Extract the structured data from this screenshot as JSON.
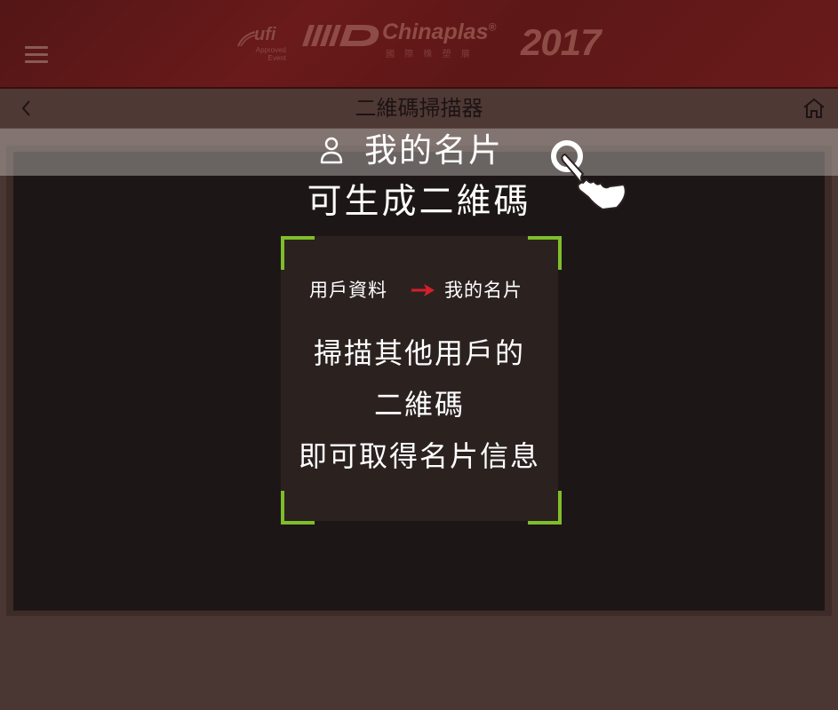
{
  "header": {
    "menu_icon": "hamburger-menu-icon",
    "ufi_logo": {
      "mark": "ufi",
      "lines": [
        "Approved",
        "Event"
      ]
    },
    "brand": {
      "name": "Chinaplas",
      "registered": "®",
      "subtitle": "國 際 橡 塑 展",
      "year": "2017"
    },
    "brand_color": "#6a1a1a"
  },
  "titlebar": {
    "back_icon": "chevron-left-icon",
    "title": "二維碼掃描器",
    "home_icon": "home-icon"
  },
  "overlay": {
    "my_card_icon": "person-icon",
    "my_card_label": "我的名片",
    "tap_icon": "tap-hand-icon",
    "generate_text": "可生成二維碼",
    "path_from": "用戶資料",
    "path_arrow_icon": "arrow-right-icon",
    "path_to": "我的名片",
    "instruction_line1": "掃描其他用戶的",
    "instruction_line2": "二維碼",
    "instruction_line3": "即可取得名片信息",
    "accent_color": "#7fbe2a",
    "arrow_color": "#d4202a"
  }
}
